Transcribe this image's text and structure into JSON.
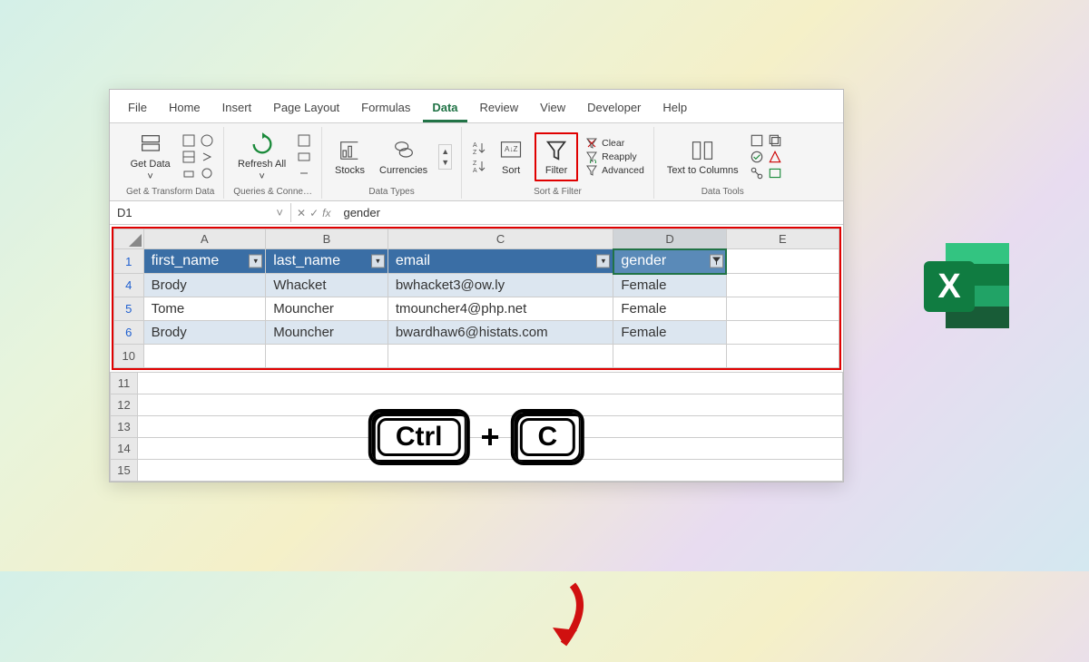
{
  "ribbon": {
    "tabs": [
      "File",
      "Home",
      "Insert",
      "Page Layout",
      "Formulas",
      "Data",
      "Review",
      "View",
      "Developer",
      "Help"
    ],
    "active_tab": "Data",
    "groups": {
      "get_transform": {
        "label": "Get & Transform Data",
        "get_data": "Get Data"
      },
      "queries": {
        "label": "Queries & Conne…",
        "refresh": "Refresh All"
      },
      "data_types": {
        "label": "Data Types",
        "stocks": "Stocks",
        "currencies": "Currencies"
      },
      "sort_filter": {
        "label": "Sort & Filter",
        "sort": "Sort",
        "filter": "Filter",
        "clear": "Clear",
        "reapply": "Reapply",
        "advanced": "Advanced"
      },
      "data_tools": {
        "label": "Data Tools",
        "text_to_columns": "Text to Columns"
      }
    }
  },
  "formula_bar": {
    "cell_ref": "D1",
    "value": "gender",
    "fx_label": "fx"
  },
  "columns": [
    "A",
    "B",
    "C",
    "D",
    "E"
  ],
  "headers": {
    "A": "first_name",
    "B": "last_name",
    "C": "email",
    "D": "gender"
  },
  "rows": [
    {
      "num": "4",
      "A": "Brody",
      "B": "Whacket",
      "C": "bwhacket3@ow.ly",
      "D": "Female"
    },
    {
      "num": "5",
      "A": "Tome",
      "B": "Mouncher",
      "C": "tmouncher4@php.net",
      "D": "Female"
    },
    {
      "num": "6",
      "A": "Brody",
      "B": "Mouncher",
      "C": "bwardhaw6@histats.com",
      "D": "Female"
    }
  ],
  "empty_rows": [
    "10",
    "11",
    "12",
    "13",
    "14",
    "15"
  ],
  "shortcut": {
    "key1": "Ctrl",
    "plus": "+",
    "key2": "C"
  }
}
